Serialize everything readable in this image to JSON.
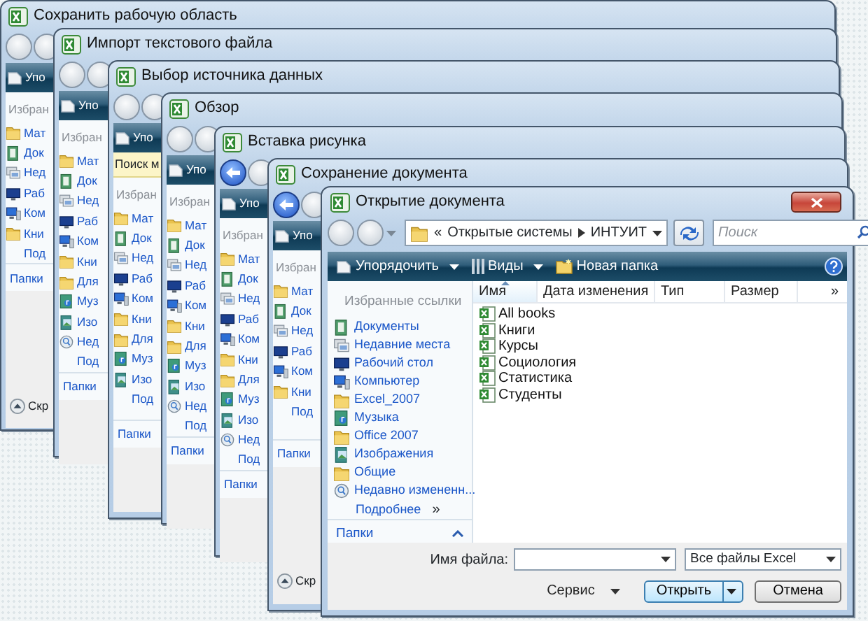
{
  "back_windows": [
    {
      "title": "Сохранить рабочую область",
      "back_enabled": false,
      "toolbar": "Упо",
      "sidebar_header": "Избран",
      "items": [
        {
          "label": "Мат",
          "kind": "folder"
        },
        {
          "label": "Док",
          "kind": "documents"
        },
        {
          "label": "Нед",
          "kind": "recent"
        },
        {
          "label": "Раб",
          "kind": "desktop"
        },
        {
          "label": "Ком",
          "kind": "computer"
        },
        {
          "label": "Кни",
          "kind": "folder"
        }
      ],
      "more": "Под",
      "folders": "Папки",
      "collapse": "Скр"
    },
    {
      "title": "Импорт текстового файла",
      "back_enabled": false,
      "toolbar": "Упо",
      "sidebar_header": "Избран",
      "items": [
        {
          "label": "Мат",
          "kind": "folder"
        },
        {
          "label": "Док",
          "kind": "documents"
        },
        {
          "label": "Нед",
          "kind": "recent"
        },
        {
          "label": "Раб",
          "kind": "desktop"
        },
        {
          "label": "Ком",
          "kind": "computer"
        },
        {
          "label": "Кни",
          "kind": "folder"
        },
        {
          "label": "Для",
          "kind": "folder"
        },
        {
          "label": "Муз",
          "kind": "music"
        },
        {
          "label": "Изо",
          "kind": "pictures"
        },
        {
          "label": "Нед",
          "kind": "search"
        }
      ],
      "more": "Под",
      "folders": "Папки"
    },
    {
      "title": "Выбор источника данных",
      "back_enabled": false,
      "toolbar": "Упо",
      "search_bar": "Поиск м",
      "sidebar_header": "Избран",
      "items": [
        {
          "label": "Мат",
          "kind": "folder"
        },
        {
          "label": "Док",
          "kind": "documents"
        },
        {
          "label": "Нед",
          "kind": "recent"
        },
        {
          "label": "Раб",
          "kind": "desktop"
        },
        {
          "label": "Ком",
          "kind": "computer"
        },
        {
          "label": "Кни",
          "kind": "folder"
        },
        {
          "label": "Для",
          "kind": "folder"
        },
        {
          "label": "Муз",
          "kind": "music"
        },
        {
          "label": "Изо",
          "kind": "pictures"
        }
      ],
      "more": "Под",
      "folders": "Папки"
    },
    {
      "title": "Обзор",
      "back_enabled": false,
      "toolbar": "Упо",
      "sidebar_header": "Избран",
      "items": [
        {
          "label": "Мат",
          "kind": "folder"
        },
        {
          "label": "Док",
          "kind": "documents"
        },
        {
          "label": "Нед",
          "kind": "recent"
        },
        {
          "label": "Раб",
          "kind": "desktop"
        },
        {
          "label": "Ком",
          "kind": "computer"
        },
        {
          "label": "Кни",
          "kind": "folder"
        },
        {
          "label": "Для",
          "kind": "folder"
        },
        {
          "label": "Муз",
          "kind": "music"
        },
        {
          "label": "Изо",
          "kind": "pictures"
        },
        {
          "label": "Нед",
          "kind": "search"
        }
      ],
      "more": "Под",
      "folders": "Папки"
    },
    {
      "title": "Вставка рисунка",
      "back_enabled": true,
      "toolbar": "Упо",
      "sidebar_header": "Избран",
      "items": [
        {
          "label": "Мат",
          "kind": "folder"
        },
        {
          "label": "Док",
          "kind": "documents"
        },
        {
          "label": "Нед",
          "kind": "recent"
        },
        {
          "label": "Раб",
          "kind": "desktop"
        },
        {
          "label": "Ком",
          "kind": "computer"
        },
        {
          "label": "Кни",
          "kind": "folder"
        },
        {
          "label": "Для",
          "kind": "folder"
        },
        {
          "label": "Муз",
          "kind": "music"
        },
        {
          "label": "Изо",
          "kind": "pictures"
        },
        {
          "label": "Нед",
          "kind": "search"
        }
      ],
      "more": "Под",
      "folders": "Папки"
    },
    {
      "title": "Сохранение документа",
      "back_enabled": true,
      "toolbar": "Упо",
      "sidebar_header": "Избран",
      "items": [
        {
          "label": "Мат",
          "kind": "folder"
        },
        {
          "label": "Док",
          "kind": "documents"
        },
        {
          "label": "Нед",
          "kind": "recent"
        },
        {
          "label": "Раб",
          "kind": "desktop"
        },
        {
          "label": "Ком",
          "kind": "computer"
        },
        {
          "label": "Кни",
          "kind": "folder"
        }
      ],
      "more": "Под",
      "folders": "Папки",
      "collapse": "Скр"
    }
  ],
  "dialog": {
    "title": "Открытие документа",
    "back_enabled": false,
    "path_prefix": "«",
    "path": [
      "Открытые системы",
      "ИНТУИТ"
    ],
    "search": {
      "placeholder": "Поиск"
    },
    "toolbar": [
      {
        "label": "Упорядочить",
        "kind": "menu"
      },
      {
        "label": "Виды",
        "kind": "menu"
      },
      {
        "label": "Новая папка",
        "kind": "button"
      }
    ],
    "sidebar_header": "Избранные ссылки",
    "links": [
      {
        "label": "Документы",
        "kind": "documents"
      },
      {
        "label": "Недавние места",
        "kind": "recent"
      },
      {
        "label": "Рабочий стол",
        "kind": "desktop"
      },
      {
        "label": "Компьютер",
        "kind": "computer"
      },
      {
        "label": "Excel_2007",
        "kind": "folder"
      },
      {
        "label": "Музыка",
        "kind": "music"
      },
      {
        "label": "Office 2007",
        "kind": "folder"
      },
      {
        "label": "Изображения",
        "kind": "pictures"
      },
      {
        "label": "Общие",
        "kind": "folder"
      },
      {
        "label": "Недавно измененн...",
        "kind": "search"
      }
    ],
    "more": "Подробнее",
    "more_mark": "»",
    "folders": "Папки",
    "columns": [
      {
        "label": "Имя",
        "sorted": true
      },
      {
        "label": "Дата изменения",
        "sorted": false
      },
      {
        "label": "Тип",
        "sorted": false
      },
      {
        "label": "Размер",
        "sorted": false
      }
    ],
    "more_columns": "»",
    "files": [
      "All books",
      "Книги",
      "Курсы",
      "Социология",
      "Статистика",
      "Студенты"
    ],
    "file_name_label": "Имя файла:",
    "file_type": "Все файлы Excel",
    "tools": "Сервис",
    "open": "Открыть",
    "cancel": "Отмена"
  }
}
